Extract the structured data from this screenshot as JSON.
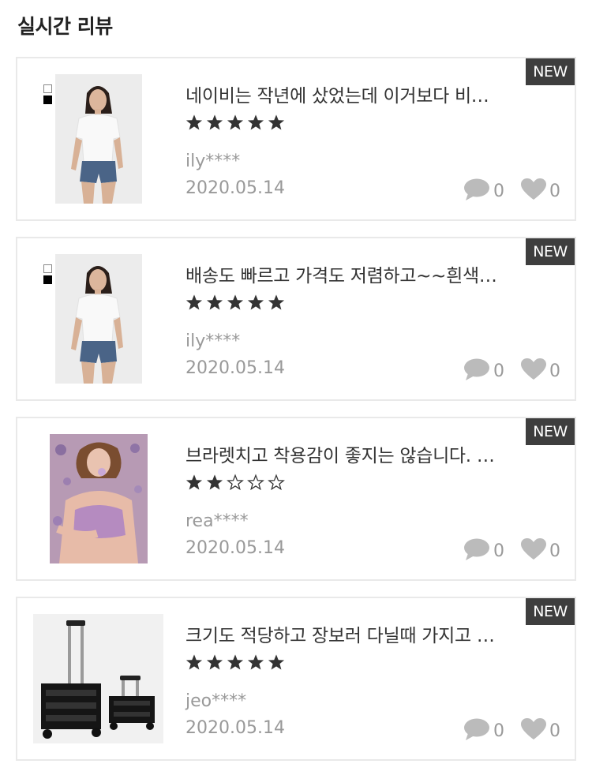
{
  "section": {
    "title": "실시간 리뷰"
  },
  "badge_label": "NEW",
  "reviews": [
    {
      "text": "네이비는 작년에 샀었는데 이거보다 비…",
      "rating": 5,
      "author": "ily****",
      "date": "2020.05.14",
      "comments": "0",
      "likes": "0",
      "image": "woman-white-tshirt-denim-shorts",
      "swatches": [
        "white",
        "black"
      ]
    },
    {
      "text": "배송도 빠르고 가격도 저렴하고~~흰색…",
      "rating": 5,
      "author": "ily****",
      "date": "2020.05.14",
      "comments": "0",
      "likes": "0",
      "image": "woman-white-tshirt-denim-shorts",
      "swatches": [
        "white",
        "black"
      ]
    },
    {
      "text": "브라렛치고 착용감이 좋지는 않습니다. …",
      "rating": 2,
      "author": "rea****",
      "date": "2020.05.14",
      "comments": "0",
      "likes": "0",
      "image": "woman-lavender-bralette-flowers"
    },
    {
      "text": "크기도 적당하고 장보러 다닐때 가지고 …",
      "rating": 5,
      "author": "jeo****",
      "date": "2020.05.14",
      "comments": "0",
      "likes": "0",
      "image": "black-folding-shopping-carts"
    }
  ],
  "icons": {
    "comment": "comment-bubble-icon",
    "like": "heart-icon",
    "star_filled": "star-filled-icon",
    "star_empty": "star-outline-icon"
  },
  "colors": {
    "badge_bg": "#3e3e3e",
    "star": "#333333",
    "meta_text": "#999999",
    "icon_gray": "#bbbbbb",
    "card_border": "#e9e9e9"
  }
}
